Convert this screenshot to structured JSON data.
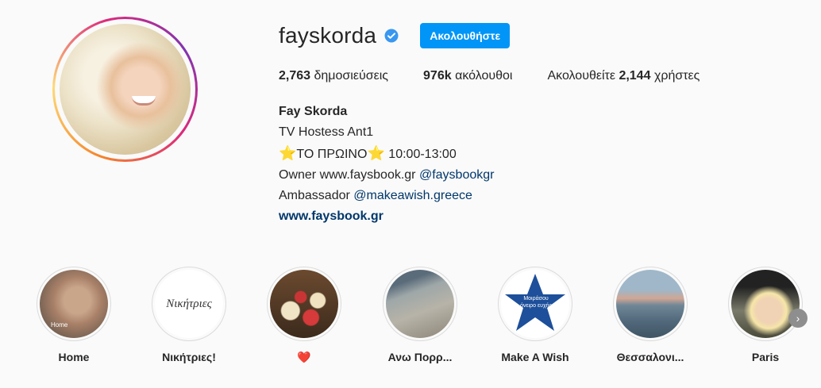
{
  "profile": {
    "username": "fayskorda",
    "follow_label": "Ακολουθήστε",
    "stats": {
      "posts_count": "2,763",
      "posts_label": "δημοσιεύσεις",
      "followers_count": "976k",
      "followers_label": "ακόλουθοι",
      "following_prefix": "Ακολουθείτε",
      "following_count": "2,144",
      "following_label": "χρήστες"
    },
    "bio": {
      "name": "Fay Skorda",
      "line1": "TV Hostess Ant1",
      "line2_star": "⭐",
      "line2_text": "ΤΟ ΠΡΩΙΝΟ",
      "line2_star2": "⭐",
      "line2_time": " 10:00-13:00",
      "line3_text": "Owner www.faysbook.gr ",
      "line3_mention": "@faysbookgr",
      "line4_text": "Ambassador ",
      "line4_mention": "@makeawish.greece",
      "website": "www.faysbook.gr"
    }
  },
  "highlights": [
    {
      "label": "Home",
      "sub": "Home"
    },
    {
      "label": "Νικήτριες!",
      "sub": "Νικήτριες"
    },
    {
      "label": "❤️"
    },
    {
      "label": "Ανω Πορρ..."
    },
    {
      "label": "Make A Wish",
      "sub": "Μοιράσου όνειρο ευχής"
    },
    {
      "label": "Θεσσαλονι..."
    },
    {
      "label": "Paris"
    }
  ],
  "colors": {
    "accent": "#0095f6",
    "link": "#00376b",
    "verified": "#3897f0"
  },
  "icons": {
    "verified": "verified-badge-icon",
    "next": "chevron-right-icon"
  }
}
